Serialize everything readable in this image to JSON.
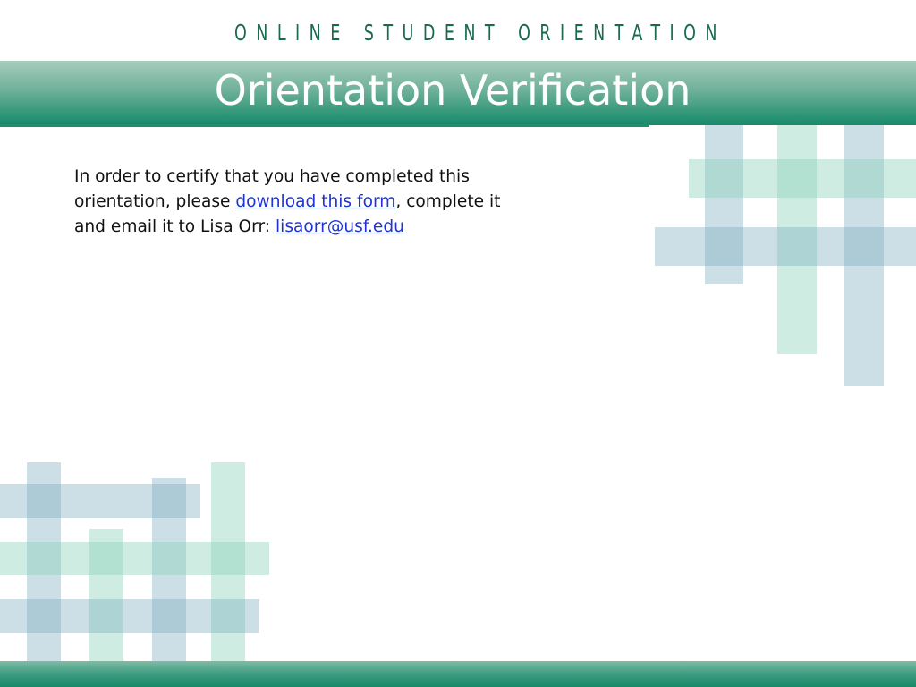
{
  "banner": {
    "text": "ONLINE STUDENT ORIENTATION"
  },
  "title": {
    "text": "Orientation Verification"
  },
  "content": {
    "text_before_link": "In order to certify that you have completed this orientation, please ",
    "form_link_text": "download this form",
    "text_between": ", complete it and email it to Lisa Orr: ",
    "email_link_text": "lisaorr@usf.edu"
  },
  "colors": {
    "brand_green": "#1a6b4d",
    "title_bar_top": "#a6ccbd",
    "title_bar_bottom": "#178b6b",
    "link_blue": "#1f33d6"
  }
}
